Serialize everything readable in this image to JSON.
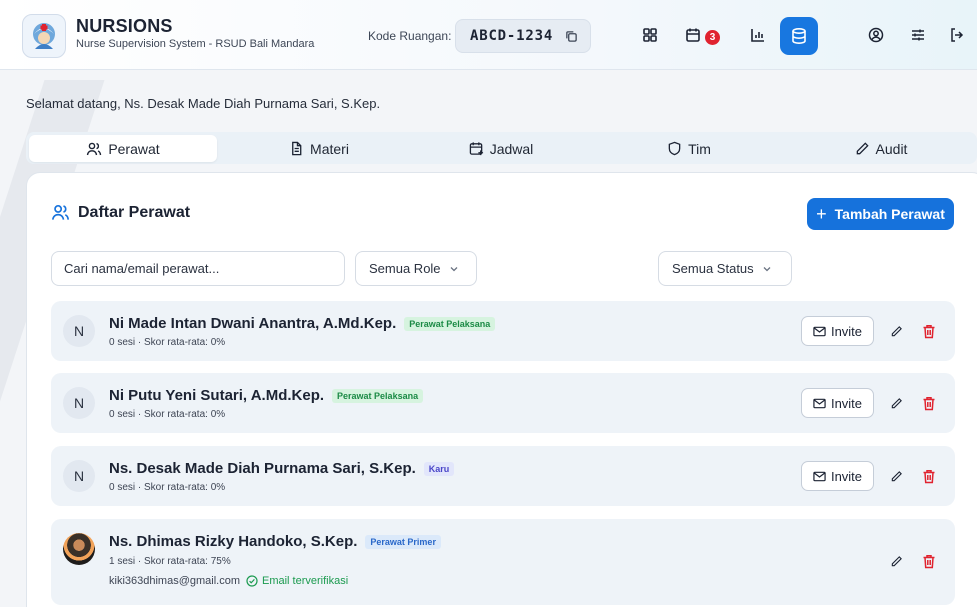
{
  "header": {
    "brand_title": "NURSIONS",
    "brand_subtitle": "Nurse Supervision System - RSUD Bali Mandara",
    "room_label": "Kode Ruangan:",
    "room_code": "ABCD-1234",
    "notification_count": "3"
  },
  "welcome": "Selamat datang, Ns. Desak Made Diah Purnama Sari, S.Kep.",
  "tabs": [
    {
      "label": "Perawat",
      "icon": "users-icon",
      "active": true
    },
    {
      "label": "Materi",
      "icon": "document-icon",
      "active": false
    },
    {
      "label": "Jadwal",
      "icon": "calendar-plus-icon",
      "active": false
    },
    {
      "label": "Tim",
      "icon": "shield-icon",
      "active": false
    },
    {
      "label": "Audit",
      "icon": "pencil-icon",
      "active": false
    }
  ],
  "card": {
    "title": "Daftar Perawat",
    "add_button": "Tambah Perawat",
    "search_placeholder": "Cari nama/email perawat...",
    "role_filter": "Semua Role",
    "status_filter": "Semua Status"
  },
  "nurses": [
    {
      "initial": "N",
      "name": "Ni Made Intan Dwani Anantra, A.Md.Kep.",
      "role": "Perawat Pelaksana",
      "meta": "0 sesi · Skor rata-rata: 0%",
      "invite": "Invite"
    },
    {
      "initial": "N",
      "name": "Ni Putu Yeni Sutari, A.Md.Kep.",
      "role": "Perawat Pelaksana",
      "meta": "0 sesi · Skor rata-rata: 0%",
      "invite": "Invite"
    },
    {
      "initial": "N",
      "name": "Ns. Desak Made Diah Purnama Sari, S.Kep.",
      "role": "Karu",
      "meta": "0 sesi · Skor rata-rata: 0%",
      "invite": "Invite"
    },
    {
      "initial": "",
      "name": "Ns. Dhimas Rizky Handoko, S.Kep.",
      "role": "Perawat Primer",
      "meta": "1 sesi · Skor rata-rata: 75%",
      "email": "kiki363dhimas@gmail.com",
      "verified": "Email terverifikasi"
    }
  ],
  "colors": {
    "primary": "#1672dc",
    "danger": "#e0232f",
    "success": "#1b9a4f"
  }
}
